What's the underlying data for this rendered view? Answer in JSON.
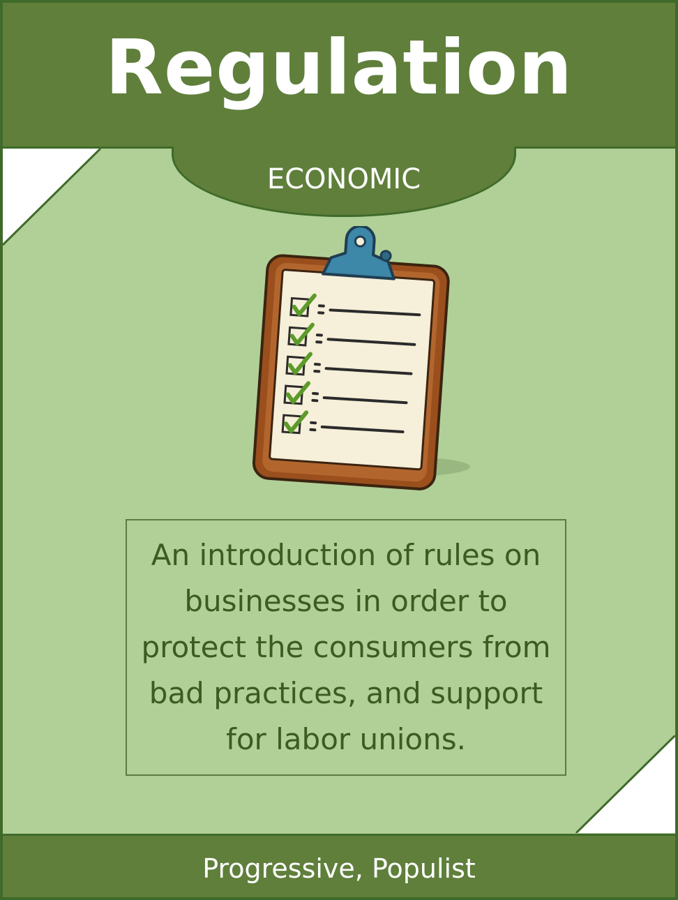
{
  "card": {
    "title": "Regulation",
    "category": "ECONOMIC",
    "description": "An introduction of rules on businesses in order to protect the consumers from bad practices, and support for labor unions.",
    "tags": "Progressive, Populist",
    "illustration_icon": "clipboard-checklist-icon"
  },
  "colors": {
    "header": "#5f7f3b",
    "body": "#b0d097",
    "border": "#3f6a2a",
    "text_dark": "#3c5a22",
    "text_light": "#ffffff"
  }
}
